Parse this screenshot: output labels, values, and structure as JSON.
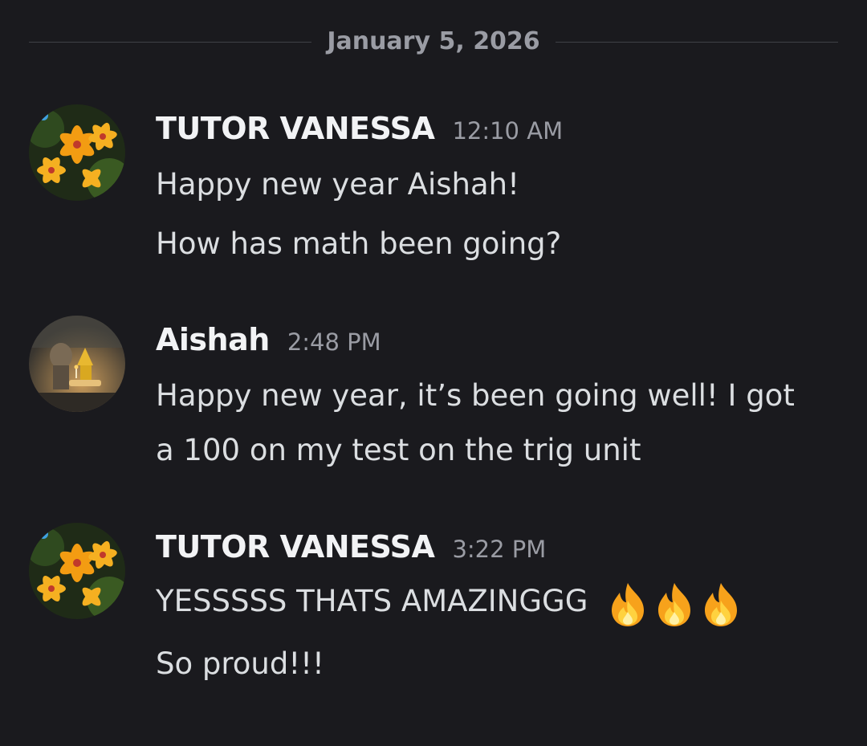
{
  "date_divider": "January 5, 2026",
  "messages": [
    {
      "author": "TUTOR VANESSA",
      "time": "12:10 AM",
      "lines": [
        "Happy new year Aishah!",
        "How has math been going?"
      ]
    },
    {
      "author": "Aishah",
      "time": "2:48 PM",
      "lines": [
        "Happy new year, it’s been going well! I got",
        "a 100 on my test on the trig unit"
      ]
    },
    {
      "author": "TUTOR VANESSA",
      "time": "3:22 PM",
      "lines": [
        "YESSSSS THATS AMAZINGGG",
        "So proud!!!"
      ]
    }
  ],
  "emoji": {
    "name": "fire-icon",
    "count": 3
  },
  "colors": {
    "background": "#1a1a1e",
    "author": "#f2f3f5",
    "text": "#dbdee1",
    "muted": "#9a9ca4"
  }
}
